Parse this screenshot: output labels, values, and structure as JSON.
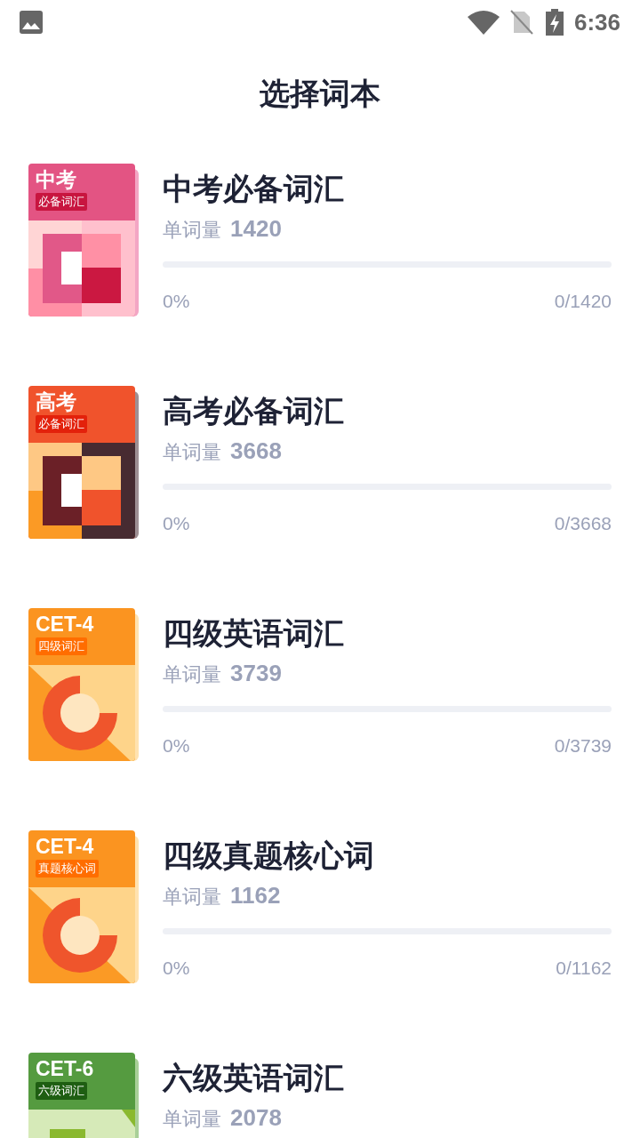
{
  "status_bar": {
    "time": "6:36"
  },
  "header": {
    "title": "选择词本"
  },
  "books": [
    {
      "title": "中考必备词汇",
      "count_label": "单词量",
      "count": "1420",
      "level": 0,
      "percent": "0%",
      "progress": "0/1420",
      "cover": {
        "title": "中考",
        "tag": "必备词汇",
        "kind": "pinkgrid",
        "color": "#e35483"
      }
    },
    {
      "title": "高考必备词汇",
      "count_label": "单词量",
      "count": "3668",
      "level": 0,
      "percent": "0%",
      "progress": "0/3668",
      "cover": {
        "title": "高考",
        "tag": "必备词汇",
        "kind": "warmgrid",
        "color": "#f0532c"
      }
    },
    {
      "title": "四级英语词汇",
      "count_label": "单词量",
      "count": "3739",
      "level": 0,
      "percent": "0%",
      "progress": "0/3739",
      "cover": {
        "title": "CET-4",
        "tag": "四级词汇",
        "kind": "ring",
        "color": "#fb9420"
      }
    },
    {
      "title": "四级真题核心词",
      "count_label": "单词量",
      "count": "1162",
      "level": 0,
      "percent": "0%",
      "progress": "0/1162",
      "cover": {
        "title": "CET-4",
        "tag": "真题核心词",
        "kind": "ring",
        "color": "#fb9420"
      }
    },
    {
      "title": "六级英语词汇",
      "count_label": "单词量",
      "count": "2078",
      "cover": {
        "title": "CET-6",
        "tag": "六级词汇",
        "kind": "green",
        "color": "#559b40"
      }
    }
  ]
}
